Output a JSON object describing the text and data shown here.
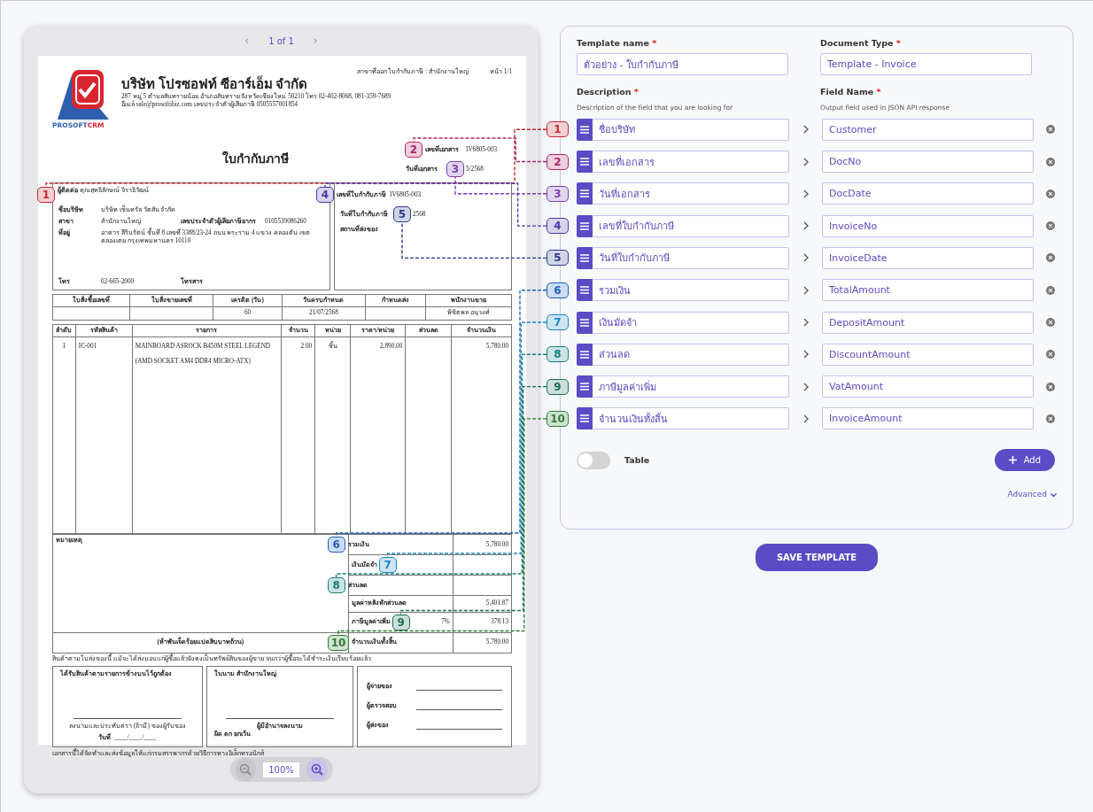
{
  "viewer": {
    "pager": {
      "prev": "‹",
      "page": "1 of 1",
      "next": "›",
      "prev_disabled": true,
      "next_disabled": true
    },
    "zoom": {
      "text": "100%",
      "zoom_out_disabled": true,
      "zoom_in_disabled": false
    }
  },
  "document": {
    "logo": {
      "text_1": "PROSOFT",
      "text_2": "CRM"
    },
    "branch": "สาขาที่ออก ใบกำกับภาษี : สำนักงานใหญ่",
    "page_no": "หน้า 1/1",
    "company": "บริษัท โปรซอฟท์ ซีอาร์เอ็ม จำกัด",
    "address": "287 หมู่ 5 ตำบลสันทรายน้อย อำเภอสันทราย จังหวัดเชียงใหม่ 50210 โทร 02-402-8068, 081-359-7689",
    "contact": "อีเมล์ sale@prosoftibiz.com เลขประจำตัวผู้เสียภาษี 0505557001854",
    "title": "ใบกำกับภาษี",
    "doc_fields": [
      {
        "label": "เลขที่เอกสาร",
        "value": "IV6805-003",
        "marker": {
          "number": "2",
          "color": "#b0246a"
        }
      },
      {
        "label": "วันที่เอกสาร",
        "value": "5/2568",
        "trailing_marker": {
          "number": "3",
          "color": "#7b3fb0"
        }
      }
    ],
    "customer": [
      [
        {
          "label": "ผู้ติดต่อ",
          "value": "คุณสุทธิลักษณ์ จิราธิวัฒน์",
          "marker": {
            "number": "1",
            "color": "#c62833"
          }
        }
      ],
      [
        {
          "label": "ชื่อบริษัท",
          "value": "บริษัท เซ็นทรัล วัตสัน จำกัด"
        }
      ],
      [
        {
          "label": "สาขา",
          "value": "สำนักงานใหญ่"
        },
        {
          "label": "เลขประจำตัวผู้เสียภาษีอากร",
          "value": "0105539086260"
        }
      ],
      [
        {
          "label": "ที่อยู่",
          "value": "อาคาร สีรินรัตน์ ชั้นที่ 8 เลขที่ 3388/23-24 ถนน พระราม 4 แขวง คลองตัน เขต คลองเตย กรุงเทพมหานคร 10110"
        }
      ],
      [
        {
          "label": "โทร",
          "value": "02-665-2000"
        },
        {
          "label": "โทรสาร"
        }
      ]
    ],
    "invoice": [
      {
        "label": "เลขที่ใบกำกับภาษี",
        "value": "IV6805-003",
        "marker": {
          "number": "4",
          "color": "#4a3aa8"
        }
      },
      {
        "label": "วันที่ใบกำกับภาษี",
        "value": "2568",
        "trailing_marker": {
          "number": "5",
          "color": "#2b3d8f"
        }
      },
      {
        "label": "สถานที่ส่งของ"
      }
    ],
    "order_info": [
      {
        "heading": "ใบสั่งซื้อเลขที่"
      },
      {
        "heading": "ใบสั่งขายเลขที่"
      },
      {
        "heading": "เครดิต (วัน)",
        "value": "60"
      },
      {
        "heading": "วันครบกำหนด",
        "value": "21/07/2568"
      },
      {
        "heading": "กำหนดส่ง"
      },
      {
        "heading": "พนักงานขาย",
        "value": "พิชิตพล อนุวงศ์"
      }
    ],
    "items": {
      "columns": [
        "ลำดับ",
        "รหัสสินค้า",
        "รายการ",
        "จำนวน",
        "หน่วย",
        "ราคา/หน่วย",
        "ส่วนลด",
        "จำนวนเงิน"
      ],
      "rows": [
        [
          "1",
          "IC-001",
          "MAINBOARD ASROCK B450M STEEL LEGEND (AMD SOCKET AM4 DDR4 MICRO-ATX)",
          "2.00",
          "ชิ้น",
          "2,890.00",
          null,
          "5,780.00"
        ]
      ]
    },
    "remarks_label": "หมายเหตุ",
    "totals": [
      {
        "label": "รวมเงิน",
        "value": "5,780.00",
        "marker": {
          "number": "6",
          "color": "#1f5fbf"
        }
      },
      {
        "label": "เงินมัดจำ",
        "trailing_marker": {
          "number": "7",
          "color": "#1b86c4"
        }
      },
      {
        "label": "ส่วนลด",
        "marker": {
          "number": "8",
          "color": "#16807f"
        }
      },
      {
        "label": "มูลค่าหลังหักส่วนลด",
        "value": "5,401.87"
      },
      {
        "label": "ภาษีมูลค่าเพิ่ม",
        "rate": "7%",
        "value": "378.13",
        "trailing_marker": {
          "number": "9",
          "color": "#1a6e5c"
        }
      },
      {
        "label": "จำนวนเงินทั้งสิ้น",
        "value": "5,780.00",
        "marker": {
          "number": "10",
          "color": "#2e7d32"
        }
      }
    ],
    "amount_words": "(ห้าพันเจ็ดร้อยแปดสิบบาทถ้วน)",
    "note": "สินค้าตามใบส่งของนี้ แม้จะได้ส่งมอบแก่ผู้ซื้อแล้วยังคงเป็นทรัพย์สินของผู้ขาย จนกว่าผู้ซื้อจะได้ชำระเงินเรียบร้อยแล้ว",
    "signatures": [
      {
        "kind": "receiver",
        "title": "ได้รับสินค้าตามรายการข้างบนไว้ถูกต้อง",
        "caption": "ลงนามและประทับตรา (ถ้ามี) ของผู้รับของ",
        "date_label": "วันที่",
        "date_blank": "____/____/____"
      },
      {
        "kind": "authority",
        "title": "ในนาม สำนักงานใหญ่",
        "caption": "ผู้มีอำนาจลงนาม",
        "remark": "ผิด ตก ยกเว้น"
      },
      {
        "kind": "signers",
        "lines": [
          "ผู้จ่ายของ",
          "ผู้ตรวจสอบ",
          "ผู้ส่งของ"
        ]
      }
    ],
    "footer": "เอกสารนี้ได้จัดทำและส่งข้อมูลให้แก่กรมสรรพากรด้วยวิธีการทางอิเล็กทรอนิกส์"
  },
  "form": {
    "template_name": {
      "label": "Template name",
      "required_mark": "*",
      "value": "ตัวอย่าง - ใบกำกับภาษี"
    },
    "document_type": {
      "label": "Document Type",
      "required_mark": "*",
      "value": "Template - Invoice"
    },
    "description_header": {
      "label": "Description",
      "required_mark": "*",
      "hint": "Description of the field that you are looking for"
    },
    "field_name_header": {
      "label": "Field Name",
      "required_mark": "*",
      "hint": "Output field used in JSON API response"
    },
    "fields": [
      {
        "marker": {
          "number": "1",
          "color": "#c62833"
        },
        "description": "ชื่อบริษัท",
        "field_name": "Customer"
      },
      {
        "marker": {
          "number": "2",
          "color": "#b0246a"
        },
        "description": "เลขที่เอกสาร",
        "field_name": "DocNo"
      },
      {
        "marker": {
          "number": "3",
          "color": "#7b3fb0"
        },
        "description": "วันที่เอกสาร",
        "field_name": "DocDate"
      },
      {
        "marker": {
          "number": "4",
          "color": "#4a3aa8"
        },
        "description": "เลขที่ใบกำกับภาษี",
        "field_name": "InvoiceNo"
      },
      {
        "marker": {
          "number": "5",
          "color": "#2b3d8f"
        },
        "description": "วันที่ใบกำกับภาษี",
        "field_name": "InvoiceDate"
      },
      {
        "marker": {
          "number": "6",
          "color": "#1f5fbf"
        },
        "description": "รวมเงิน",
        "field_name": "TotalAmount"
      },
      {
        "marker": {
          "number": "7",
          "color": "#1b86c4"
        },
        "description": "เงินมัดจำ",
        "field_name": "DepositAmount"
      },
      {
        "marker": {
          "number": "8",
          "color": "#16807f"
        },
        "description": "ส่วนลด",
        "field_name": "DiscountAmount"
      },
      {
        "marker": {
          "number": "9",
          "color": "#1a6e5c"
        },
        "description": "ภาษีมูลค่าเพิ่ม",
        "field_name": "VatAmount"
      },
      {
        "marker": {
          "number": "10",
          "color": "#2e7d32"
        },
        "description": "จำนวนเงินทั้งสิ้น",
        "field_name": "InvoiceAmount"
      }
    ],
    "table_toggle": {
      "label": "Table",
      "on": false
    },
    "add_button": "Add",
    "advanced_link": "Advanced",
    "save_button": "SAVE TEMPLATE"
  }
}
